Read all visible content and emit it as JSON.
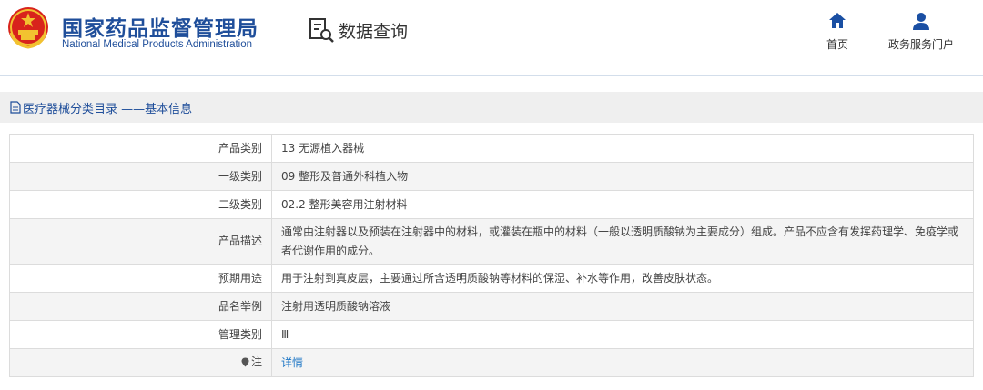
{
  "header": {
    "org_name_cn": "国家药品监督管理局",
    "org_name_en": "National Medical Products Administration",
    "query_label": "数据查询",
    "nav": [
      {
        "label": "首页",
        "icon": "home-icon"
      },
      {
        "label": "政务服务门户",
        "icon": "user-icon"
      }
    ],
    "colors": {
      "brand": "#1f4e9a",
      "nav_icon": "#1a4fa3"
    }
  },
  "section": {
    "icon": "document-icon",
    "title": "医疗器械分类目录 ——基本信息"
  },
  "rows": [
    {
      "label": "产品类别",
      "value": "13 无源植入器械"
    },
    {
      "label": "一级类别",
      "value": "09 整形及普通外科植入物"
    },
    {
      "label": "二级类别",
      "value": "02.2 整形美容用注射材料"
    },
    {
      "label": "产品描述",
      "value": "通常由注射器以及预装在注射器中的材料，或灌装在瓶中的材料（一般以透明质酸钠为主要成分）组成。产品不应含有发挥药理学、免疫学或者代谢作用的成分。"
    },
    {
      "label": "预期用途",
      "value": "用于注射到真皮层，主要通过所含透明质酸钠等材料的保湿、补水等作用，改善皮肤状态。"
    },
    {
      "label": "品名举例",
      "value": "注射用透明质酸钠溶液"
    },
    {
      "label": "管理类别",
      "value": "Ⅲ"
    },
    {
      "label": "注",
      "value": "详情",
      "icon": "pin-icon"
    }
  ],
  "link_color": "#1a74c4"
}
